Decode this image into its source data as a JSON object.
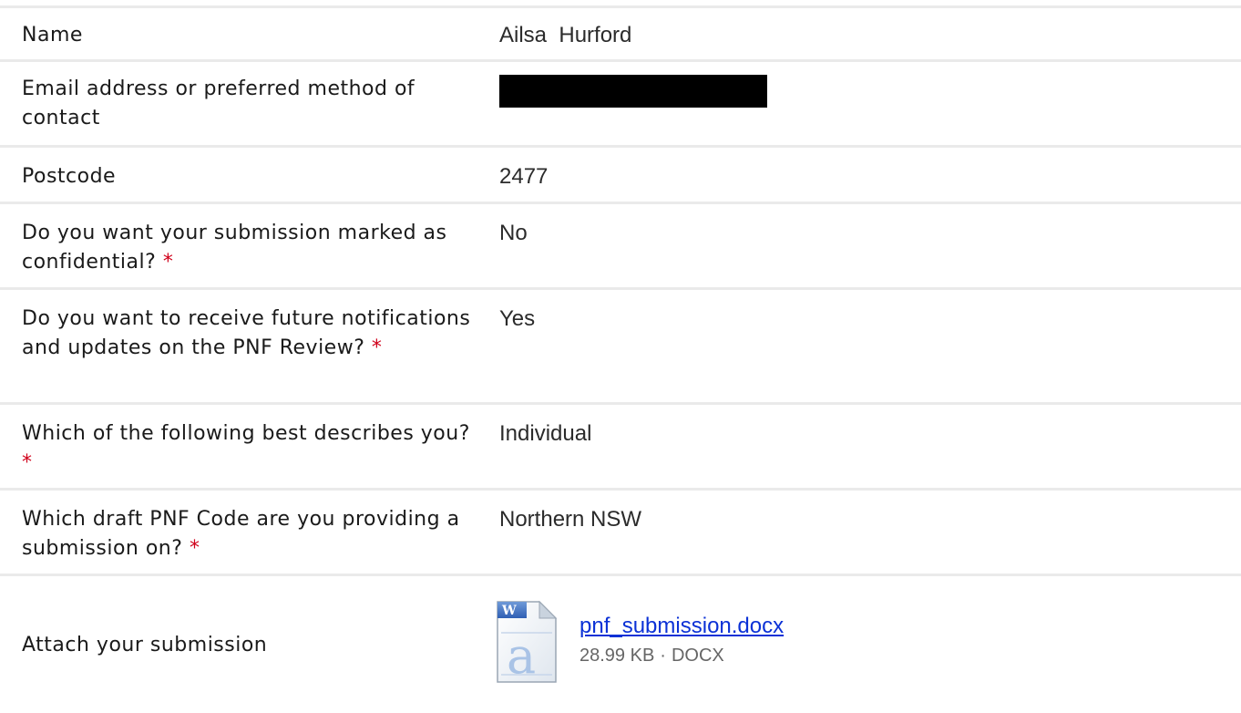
{
  "rows": [
    {
      "label": "Name",
      "value": "Ailsa  Hurford",
      "required": false
    },
    {
      "label": "Email address or preferred method of contact",
      "value": "",
      "redacted": true,
      "required": false
    },
    {
      "label": "Postcode",
      "value": "2477",
      "required": false
    },
    {
      "label": "Do you want your submission marked as confidential?",
      "value": "No",
      "required": true
    },
    {
      "label": "Do you want to receive future notifications and updates on the PNF Review?",
      "value": "Yes",
      "required": true
    },
    {
      "label": "Which of the following best describes you?",
      "value": "Individual",
      "required": true
    },
    {
      "label": "Which draft PNF Code are you providing a submission on?",
      "value": "Northern NSW",
      "required": true
    }
  ],
  "attachment": {
    "label": "Attach your submission",
    "file_name": "pnf_submission.docx",
    "file_size": "28.99 KB",
    "separator": "·",
    "file_type": "DOCX",
    "icon": "word-document-icon"
  },
  "required_marker": "*",
  "colors": {
    "required": "#d0021b",
    "link": "#0b31d6",
    "divider": "#eaeaea",
    "redaction": "#000000"
  }
}
